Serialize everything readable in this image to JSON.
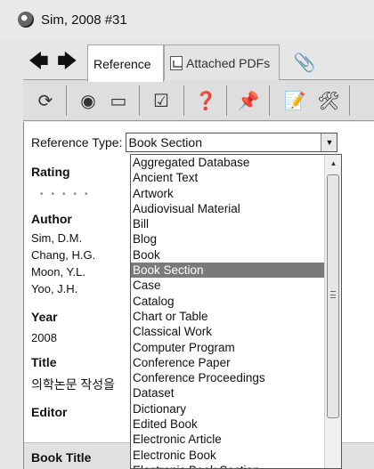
{
  "window": {
    "title": "Sim, 2008 #31"
  },
  "nav": {
    "back_icon": "left-arrow-icon",
    "forward_icon": "right-arrow-icon",
    "back_glyph": "🡄",
    "forward_glyph": "🡆"
  },
  "tabs": [
    {
      "label": "Reference",
      "active": true
    },
    {
      "label": "Attached PDFs",
      "active": false
    }
  ],
  "attach_icon": "📎",
  "toolbar": {
    "icons": [
      "refresh-icon",
      "globe-icon",
      "folder-icon",
      "check-document-icon",
      "find-text-icon",
      "pin-icon",
      "edit-document-icon",
      "tools-icon"
    ],
    "glyphs": [
      "⟳",
      "◉",
      "▭",
      "☑",
      "❓",
      "📌",
      "📝",
      "🛠"
    ]
  },
  "reference_type": {
    "label": "Reference Type:",
    "value": "Book Section"
  },
  "fields": {
    "rating_label": "Rating",
    "author_label": "Author",
    "authors": [
      "Sim, D.M.",
      "Chang, H.G.",
      "Moon, Y.L.",
      "Yoo, J.H."
    ],
    "year_label": "Year",
    "year_value": "2008",
    "title_label": "Title",
    "title_value": "의학논문 작성을",
    "editor_label": "Editor",
    "book_title_label": "Book Title"
  },
  "dropdown": {
    "options": [
      "Aggregated Database",
      "Ancient Text",
      "Artwork",
      "Audiovisual Material",
      "Bill",
      "Blog",
      "Book",
      "Book Section",
      "Case",
      "Catalog",
      "Chart or Table",
      "Classical Work",
      "Computer Program",
      "Conference Paper",
      "Conference Proceedings",
      "Dataset",
      "Dictionary",
      "Edited Book",
      "Electronic Article",
      "Electronic Book",
      "Electronic Book Section"
    ],
    "selected_index": 7
  }
}
